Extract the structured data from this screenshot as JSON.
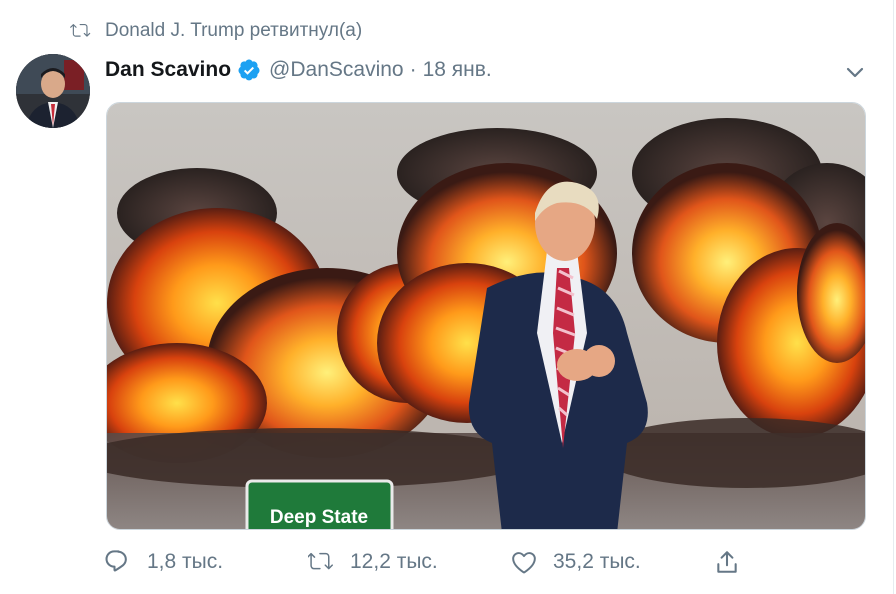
{
  "retweet_context": {
    "icon": "retweet-icon",
    "text": "Donald J. Trump ретвитнул(а)"
  },
  "tweet": {
    "avatar_icon": "avatar",
    "display_name": "Dan Scavino",
    "verified_icon": "verified-badge-icon",
    "handle": "@DanScavino",
    "separator": "·",
    "timestamp": "18 янв.",
    "menu_icon": "chevron-down-icon",
    "media": {
      "sign_text": "Deep State",
      "description_icons": [
        "explosion",
        "person-in-suit",
        "road-sign"
      ]
    }
  },
  "actions": {
    "reply": {
      "icon": "reply-icon",
      "count": "1,8 тыс."
    },
    "retweet": {
      "icon": "retweet-icon",
      "count": "12,2 тыс."
    },
    "like": {
      "icon": "heart-icon",
      "count": "35,2 тыс."
    },
    "share": {
      "icon": "share-icon"
    }
  },
  "colors": {
    "text_primary": "#14171a",
    "text_secondary": "#657786",
    "verified_blue": "#1da1f2",
    "border": "#ccd6dd",
    "sign_green": "#1f7a3a"
  }
}
